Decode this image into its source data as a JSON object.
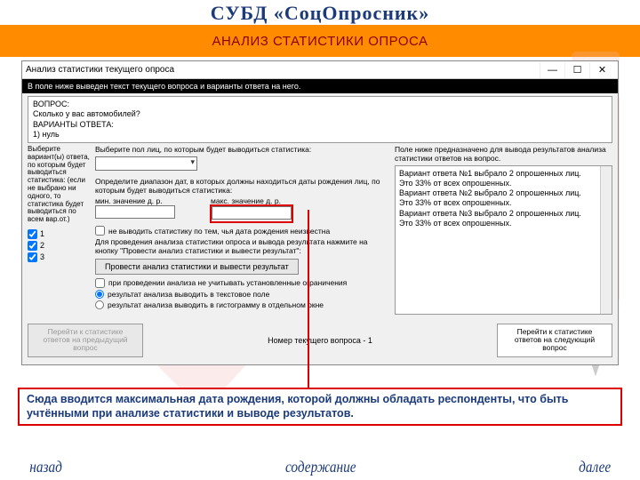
{
  "app_title": "СУБД «СоцОпросник»",
  "orange_header": "АНАЛИЗ СТАТИСТИКИ ОПРОСА",
  "window": {
    "title": "Анализ статистики текущего опроса",
    "min": "—",
    "max": "☐",
    "close": "✕",
    "intro": "В поле ниже выведен текст текущего вопроса и варианты ответа на него.",
    "question": {
      "q_label": "ВОПРОС:",
      "q_text": "Сколько у вас автомобилей?",
      "a_label": "ВАРИАНТЫ ОТВЕТА:",
      "a1": "1) нуль"
    },
    "left": {
      "hdr": "Выберите вариант(ы) ответа, по которым будет выводиться статистика: (если не выбрано ни одного, то статистика будет выводиться по всем вар.от.)",
      "c1": "1",
      "c2": "2",
      "c3": "3"
    },
    "mid": {
      "sex_label": "Выберите пол лиц, по которым будет выводиться статистика:",
      "range_label": "Определите диапазон дат, в которых должны находиться даты рождения лиц, по которым будет выводиться статистика:",
      "min_label": "мин. значение д. р.",
      "max_label": "макс. значение д. р.",
      "unknown_cb": "не выводить статистику по тем, чья дата рождения неизвестна",
      "run_note": "Для проведения анализа статистики опроса и вывода результата нажмите на кнопку \"Провести анализ статистики и вывести результат\":",
      "run_btn": "Провести анализ статистики и вывести результат",
      "ignore_cb": "при проведении анализа не учитывать установленные ограничения",
      "r_text": "результат анализа выводить в текстовое поле",
      "r_hist": "результат анализа выводить в гистограмму в отдельном окне"
    },
    "right": {
      "hdr": "Поле ниже предназначено для вывода результатов анализа статистики ответов на вопрос.",
      "l1": "Вариант ответа №1 выбрало 2 опрошенных лиц.",
      "l2": "Это 33% от всех опрошенных.",
      "l3": "Вариант ответа №2 выбрало 2 опрошенных лиц.",
      "l4": "Это 33% от всех опрошенных.",
      "l5": "Вариант ответа №3 выбрало 2 опрошенных лиц.",
      "l6": "Это 33% от всех опрошенных."
    },
    "nav": {
      "prev": "Перейти к статистике ответов на предыдущий вопрос",
      "cur": "Номер текущего вопроса - 1",
      "next": "Перейти к статистике ответов на следующий вопрос"
    }
  },
  "callout": "Сюда вводится максимальная дата рождения, которой должны обладать респонденты, что быть учтёнными при анализе статистики и выводе результатов.",
  "footer": {
    "back": "назад",
    "toc": "содержание",
    "next": "далее"
  }
}
